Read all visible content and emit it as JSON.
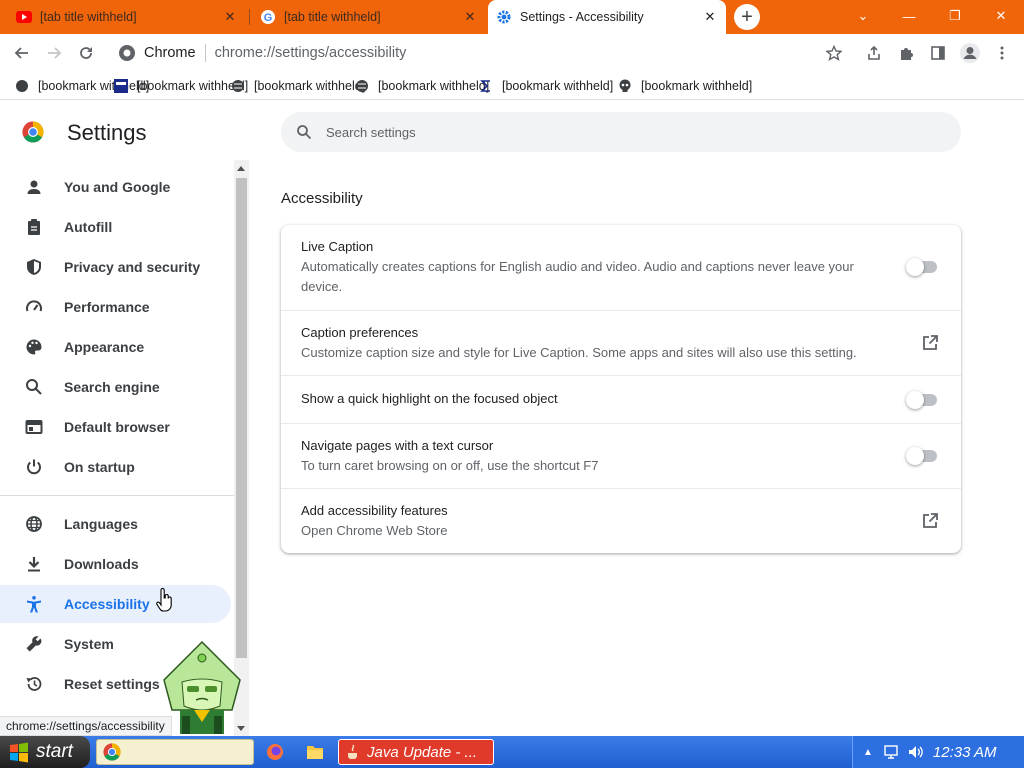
{
  "window": {
    "tabs": [
      {
        "title": "[tab title withheld]",
        "close": "✕"
      },
      {
        "title": "[tab title withheld]",
        "close": "✕"
      },
      {
        "title": "Settings - Accessibility",
        "close": "✕"
      }
    ],
    "new_tab": "+",
    "controls": {
      "tab_search": "⌄",
      "minimize": "—",
      "restore": "❐",
      "close": "✕"
    }
  },
  "omnibox": {
    "site_label": "Chrome",
    "url": "chrome://settings/accessibility"
  },
  "bookmarks": [
    {
      "label": "[bookmark withheld]"
    },
    {
      "label": "[bookmark withheld]"
    },
    {
      "label": "[bookmark withheld]"
    },
    {
      "label": "[bookmark withheld]"
    },
    {
      "label": "[bookmark withheld]"
    },
    {
      "label": "[bookmark withheld]"
    }
  ],
  "settings": {
    "title": "Settings",
    "search_placeholder": "Search settings",
    "nav": [
      {
        "label": "You and Google"
      },
      {
        "label": "Autofill"
      },
      {
        "label": "Privacy and security"
      },
      {
        "label": "Performance"
      },
      {
        "label": "Appearance"
      },
      {
        "label": "Search engine"
      },
      {
        "label": "Default browser"
      },
      {
        "label": "On startup"
      },
      {
        "label": "Languages"
      },
      {
        "label": "Downloads"
      },
      {
        "label": "Accessibility"
      },
      {
        "label": "System"
      },
      {
        "label": "Reset settings"
      }
    ],
    "active_nav": "Accessibility",
    "section_title": "Accessibility",
    "rows": [
      {
        "title": "Live Caption",
        "subtitle": "Automatically creates captions for English audio and video. Audio and captions never leave your device.",
        "control": "toggle",
        "enabled": false
      },
      {
        "title": "Caption preferences",
        "subtitle": "Customize caption size and style for Live Caption. Some apps and sites will also use this setting.",
        "control": "external-link"
      },
      {
        "title": "Show a quick highlight on the focused object",
        "subtitle": "",
        "control": "toggle",
        "enabled": false
      },
      {
        "title": "Navigate pages with a text cursor",
        "subtitle": "To turn caret browsing on or off, use the shortcut F7",
        "control": "toggle",
        "enabled": false
      },
      {
        "title": "Add accessibility features",
        "subtitle": "Open Chrome Web Store",
        "control": "external-link"
      }
    ]
  },
  "status_bar": "chrome://settings/accessibility",
  "taskbar": {
    "start": "start",
    "java_task": "Java Update - ...",
    "clock": "12:33 AM"
  },
  "colors": {
    "tabstrip": "#f0640a",
    "accent": "#1a73e8",
    "active_nav_bg": "#e8f0fe",
    "taskbar": "#1f5fd0"
  }
}
